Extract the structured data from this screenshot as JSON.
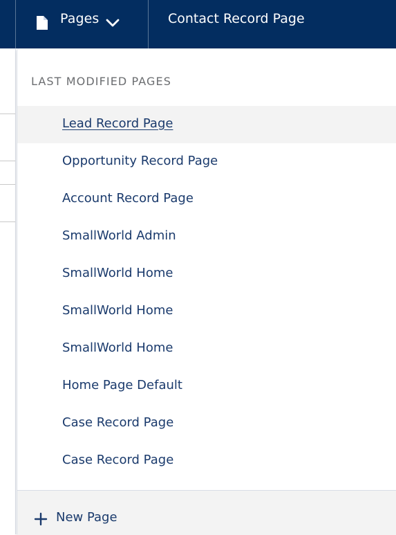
{
  "topbar": {
    "pages_label": "Pages",
    "current_page": "Contact Record Page"
  },
  "dropdown": {
    "header": "LAST MODIFIED PAGES",
    "items": [
      {
        "label": "Lead Record Page"
      },
      {
        "label": "Opportunity Record Page"
      },
      {
        "label": "Account Record Page"
      },
      {
        "label": "SmallWorld Admin"
      },
      {
        "label": "SmallWorld Home"
      },
      {
        "label": "SmallWorld Home"
      },
      {
        "label": "SmallWorld Home"
      },
      {
        "label": "Home Page Default"
      },
      {
        "label": "Case Record Page"
      },
      {
        "label": "Case Record Page"
      }
    ],
    "new_page_label": "New Page"
  },
  "colors": {
    "topbar_bg": "#032d60",
    "link": "#1a3a6c",
    "hover_bg": "#f3f3f3"
  }
}
